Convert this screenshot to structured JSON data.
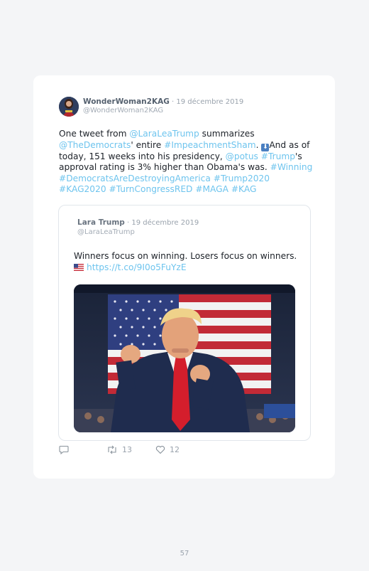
{
  "tweet": {
    "author": "WonderWoman2KAG",
    "date": "· 19 décembre 2019",
    "handle": "@WonderWoman2KAG",
    "text": {
      "t1": "One tweet from ",
      "m1": "@LaraLeaTrump",
      "t2": " summarizes ",
      "m2": "@TheDemocrats",
      "t3": "' entire ",
      "h1": "#ImpeachmentSham",
      "t4": ". ",
      "t5": "And as of today, 151 weeks into his presidency, ",
      "m3": "@potus",
      "t6": " ",
      "h2": "#Trump",
      "t7": "'s approval rating is 3% higher than Obama's was. ",
      "h3": "#Winning",
      "h4": "#DemocratsAreDestroyingAmerica",
      "h5": "#Trump2020",
      "h6": "#KAG2020",
      "h7": "#TurnCongressRED",
      "h8": "#MAGA",
      "h9": "#KAG"
    }
  },
  "quoted": {
    "author": "Lara Trump",
    "date": "· 19 décembre 2019",
    "handle": "@LaraLeaTrump",
    "text": "Winners focus on winning. Losers focus on winners.",
    "link": "https://t.co/9I0o5FuYzE"
  },
  "actions": {
    "retweets": "13",
    "likes": "12"
  },
  "page": {
    "number": "57"
  },
  "icons": {
    "reply": "reply-icon",
    "retweet": "retweet-icon",
    "like": "heart-icon",
    "arrow": "down-arrow-emoji-icon",
    "flag": "us-flag-icon"
  },
  "colors": {
    "link": "#6ec4ee",
    "text": "#1c2128",
    "muted": "#9aa3ad"
  }
}
